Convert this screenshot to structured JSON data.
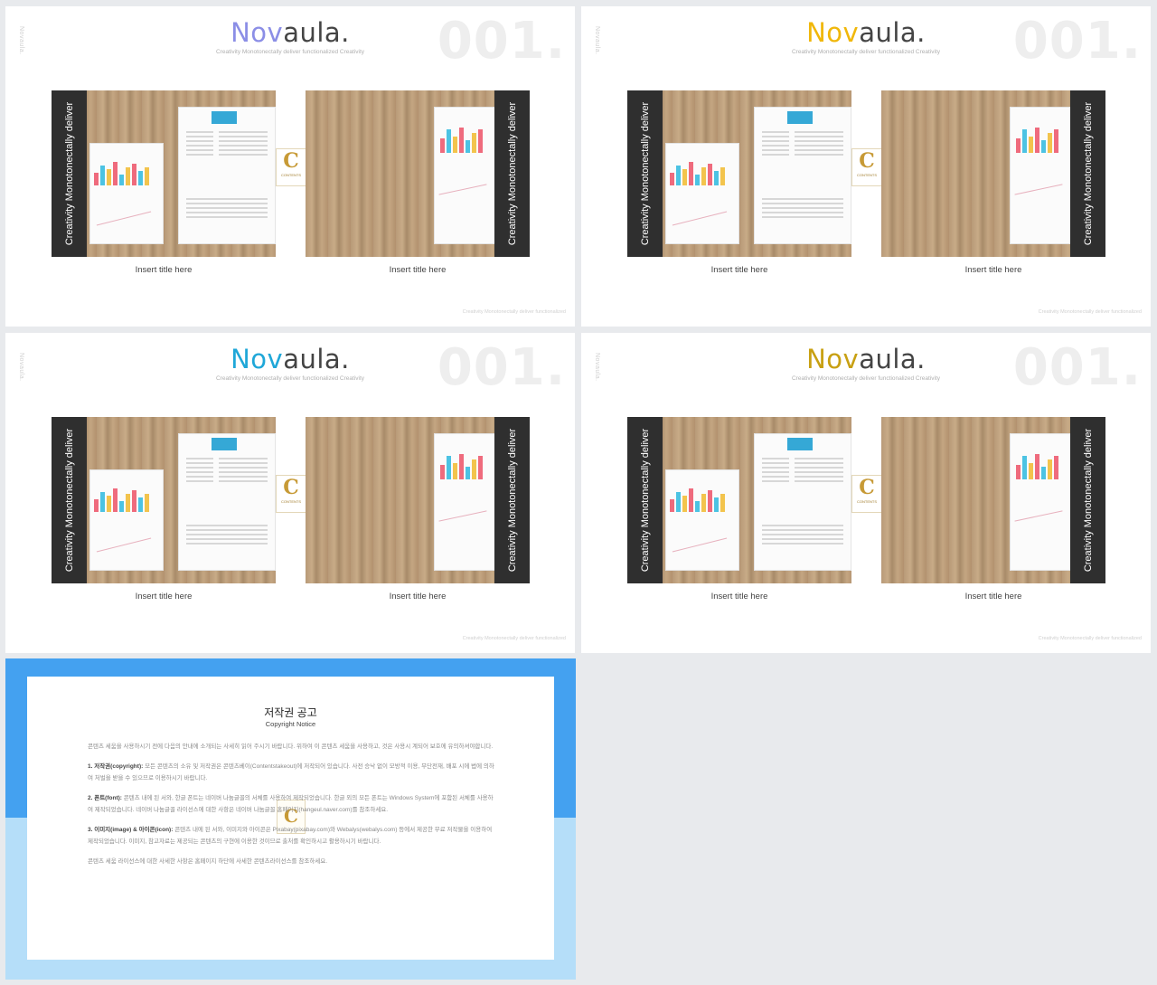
{
  "slides": [
    {
      "brand_accent": "Nov",
      "brand_rest": "aula.",
      "accent_color": "#8b8ee6",
      "subtitle": "Creativity Monotonectally deliver functionalized Creativity",
      "number": "001.",
      "side_label": "Novaula.",
      "bar_text_left": "Creativity Monotonectally deliver",
      "bar_text_right": "Creativity Monotonectally deliver",
      "caption_left": "Insert title here",
      "caption_right": "Insert title here",
      "footer": "Creativity Monotonectally deliver functionalized"
    },
    {
      "brand_accent": "Nov",
      "brand_rest": "aula.",
      "accent_color": "#f0b70a",
      "subtitle": "Creativity Monotonectally deliver functionalized Creativity",
      "number": "001.",
      "side_label": "Novaula.",
      "bar_text_left": "Creativity Monotonectally deliver",
      "bar_text_right": "Creativity Monotonectally deliver",
      "caption_left": "Insert title here",
      "caption_right": "Insert title here",
      "footer": "Creativity Monotonectally deliver functionalized"
    },
    {
      "brand_accent": "Nov",
      "brand_rest": "aula.",
      "accent_color": "#1fa7d8",
      "subtitle": "Creativity Monotonectally deliver functionalized Creativity",
      "number": "001.",
      "side_label": "Novaula.",
      "bar_text_left": "Creativity Monotonectally deliver",
      "bar_text_right": "Creativity Monotonectally deliver",
      "caption_left": "Insert title here",
      "caption_right": "Insert title here",
      "footer": "Creativity Monotonectally deliver functionalized"
    },
    {
      "brand_accent": "Nov",
      "brand_rest": "aula.",
      "accent_color": "#c8a012",
      "subtitle": "Creativity Monotonectally deliver functionalized Creativity",
      "number": "001.",
      "side_label": "Novaula.",
      "bar_text_left": "Creativity Monotonectally deliver",
      "bar_text_right": "Creativity Monotonectally deliver",
      "caption_left": "Insert title here",
      "caption_right": "Insert title here",
      "footer": "Creativity Monotonectally deliver functionalized"
    }
  ],
  "logo_badge": {
    "letter": "C",
    "text": "CONTENTS"
  },
  "notice": {
    "title": "저작권 공고",
    "subtitle": "Copyright Notice",
    "intro": "콘텐츠 세움을 사용하시기 전에 다음의 안내에 소개되는 사세히 읽어 주시기 바랍니다. 위하여 이 콘텐츠 세움을 사용하고, 것은 사용시 계되어 보호에 유의하셔야합니다.",
    "copyright_label": "1. 저작권(copyright):",
    "copyright_text": " 모든 콘텐츠의 소유 및 저작권은 콘텐츠베이(Contentstakeout)에 저작되어 있습니다. 사전 승낙 없이 모방적 이용, 무단전재, 배포 시에 법에 의하여 처벌을 받을 수 있으므로 이용하시기 바랍니다.",
    "font_label": "2. 폰트(font):",
    "font_text": " 콘텐츠 내에 된 서와, 한글 폰트는 네이버 나눔글꼴의 서체를 사용하여 제작되었습니다. 한글 외의 모든 폰트는 Windows System에 포함된 서체를 사용하여 제작되었습니다. 네이버 나눔글꼴 라이선스에 대한 사항은 네이버 나눔글꼴 홈페이지(hangeul.naver.com)를 참조하세요.",
    "image_label": "3. 이미지(image) & 아이콘(icon):",
    "image_text": " 콘텐츠 내에 된 서와, 이미지와 아이콘은 Pixabay(pixabay.com)와 Webalys(webalys.com) 등에서 제공한 무료 저작물을 이용하여 제작되었습니다. 이미지, 참고자료는 제공되는 콘텐츠의 구현에 이용한 것이므로 출처를 확인하시고 활용하시기 바랍니다.",
    "closing": "콘텐츠 세움 라이선스에 대한 사세한 사항은 홈페이지 하단에 사세한 콘텐츠라이선스를 참조하세요."
  }
}
